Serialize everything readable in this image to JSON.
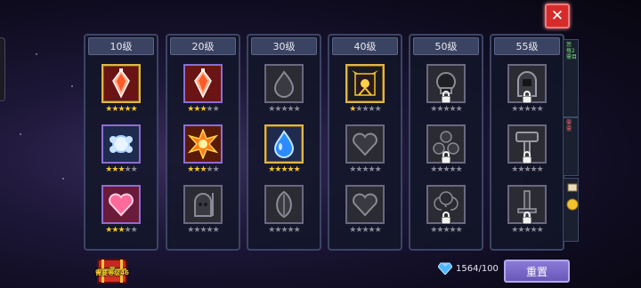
{
  "columns": [
    {
      "label": "10级",
      "slots": [
        {
          "icon": "flame-crystal-icon",
          "state": "gold",
          "bg": "red",
          "stars": 5
        },
        {
          "icon": "ice-gem-icon",
          "state": "purple",
          "bg": "blue",
          "stars": 3
        },
        {
          "icon": "heart-icon",
          "state": "purple",
          "bg": "pink",
          "stars": 3
        }
      ]
    },
    {
      "label": "20级",
      "slots": [
        {
          "icon": "flame-crystal-icon",
          "state": "purple",
          "bg": "red",
          "stars": 3
        },
        {
          "icon": "explosion-icon",
          "state": "purple",
          "bg": "orange",
          "stars": 3
        },
        {
          "icon": "reaper-icon",
          "state": "grey",
          "bg": "",
          "stars": 0
        }
      ]
    },
    {
      "label": "30级",
      "slots": [
        {
          "icon": "fire-drop-icon",
          "state": "grey",
          "bg": "",
          "stars": 0
        },
        {
          "icon": "water-drop-icon",
          "state": "gold",
          "bg": "blue",
          "stars": 5
        },
        {
          "icon": "leaf-icon",
          "state": "grey",
          "bg": "",
          "stars": 0
        }
      ]
    },
    {
      "label": "40级",
      "slots": [
        {
          "icon": "dark-lord-icon",
          "state": "gold",
          "bg": "",
          "stars": 1
        },
        {
          "icon": "heart-icon",
          "state": "grey",
          "bg": "",
          "stars": 0
        },
        {
          "icon": "heart-icon",
          "state": "grey",
          "bg": "",
          "stars": 0
        }
      ]
    },
    {
      "label": "50级",
      "slots": [
        {
          "icon": "skull-icon",
          "state": "grey",
          "bg": "",
          "stars": 0,
          "locked": true
        },
        {
          "icon": "orbs-icon",
          "state": "grey",
          "bg": "",
          "stars": 0,
          "locked": true
        },
        {
          "icon": "cloud-icon",
          "state": "grey",
          "bg": "",
          "stars": 0,
          "locked": true
        }
      ]
    },
    {
      "label": "55级",
      "slots": [
        {
          "icon": "hooded-figure-icon",
          "state": "grey",
          "bg": "",
          "stars": 0,
          "locked": true
        },
        {
          "icon": "hammer-icon",
          "state": "grey",
          "bg": "",
          "stars": 0,
          "locked": true
        },
        {
          "icon": "sword-icon",
          "state": "grey",
          "bg": "",
          "stars": 0,
          "locked": true
        }
      ]
    }
  ],
  "side_notes": [
    {
      "text": "惩 每2 需目",
      "color": "green"
    },
    {
      "text": "需 需",
      "color": "red"
    }
  ],
  "chest": {
    "label": "需要等级46",
    "icon": "treasure-chest-icon"
  },
  "currency": {
    "icon": "diamond-icon",
    "value": "1564/100"
  },
  "reset_label": "重置",
  "close_icon": "close-icon",
  "colors": {
    "star_on": "#f4c430",
    "star_off": "#8a8a96",
    "gold_frame": "#e0b64a",
    "purple_frame": "#8c6dd2",
    "close_red": "#d62b2b"
  }
}
